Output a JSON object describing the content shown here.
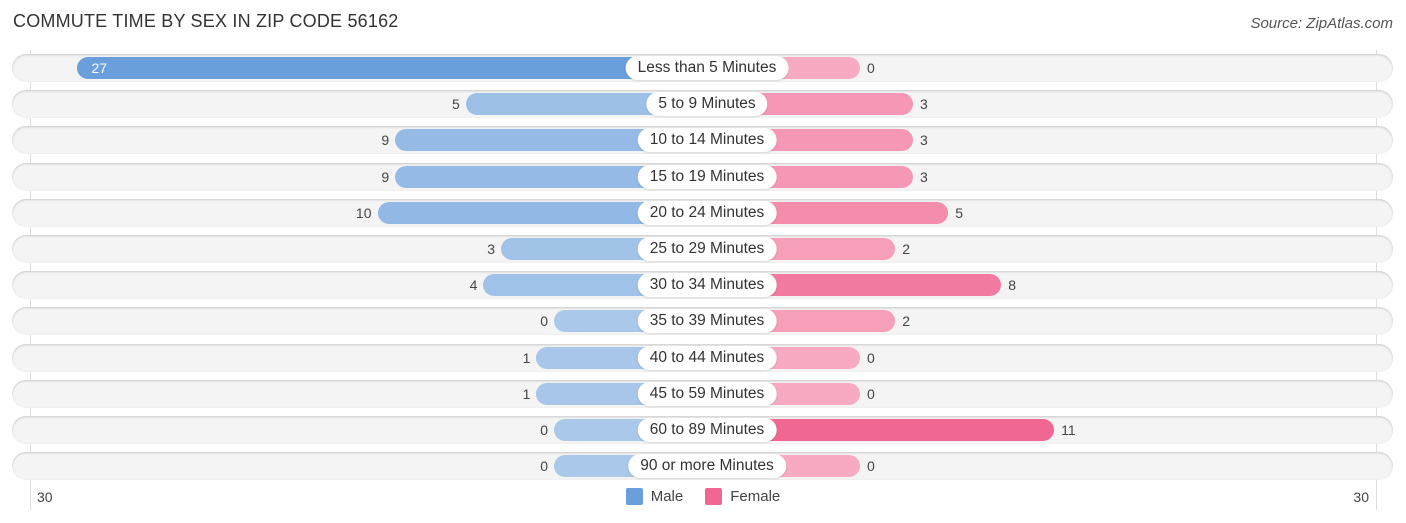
{
  "header": {
    "title": "COMMUTE TIME BY SEX IN ZIP CODE 56162",
    "source": "Source: ZipAtlas.com"
  },
  "chart_data": {
    "type": "bar",
    "orientation": "horizontal-diverging",
    "title": "COMMUTE TIME BY SEX IN ZIP CODE 56162",
    "categories": [
      "Less than 5 Minutes",
      "5 to 9 Minutes",
      "10 to 14 Minutes",
      "15 to 19 Minutes",
      "20 to 24 Minutes",
      "25 to 29 Minutes",
      "30 to 34 Minutes",
      "35 to 39 Minutes",
      "40 to 44 Minutes",
      "45 to 59 Minutes",
      "60 to 89 Minutes",
      "90 or more Minutes"
    ],
    "series": [
      {
        "name": "Male",
        "color": "#6a9fdc",
        "values": [
          27,
          5,
          9,
          9,
          10,
          3,
          4,
          0,
          1,
          1,
          0,
          0
        ]
      },
      {
        "name": "Female",
        "color": "#f06792",
        "values": [
          0,
          3,
          3,
          3,
          5,
          2,
          8,
          2,
          0,
          0,
          11,
          0
        ]
      }
    ],
    "xlim": [
      -30,
      30
    ],
    "axis_tick_labels": {
      "left": "30",
      "right": "30"
    },
    "legend": {
      "position": "bottom-center",
      "items": [
        "Male",
        "Female"
      ]
    },
    "grid": false
  }
}
